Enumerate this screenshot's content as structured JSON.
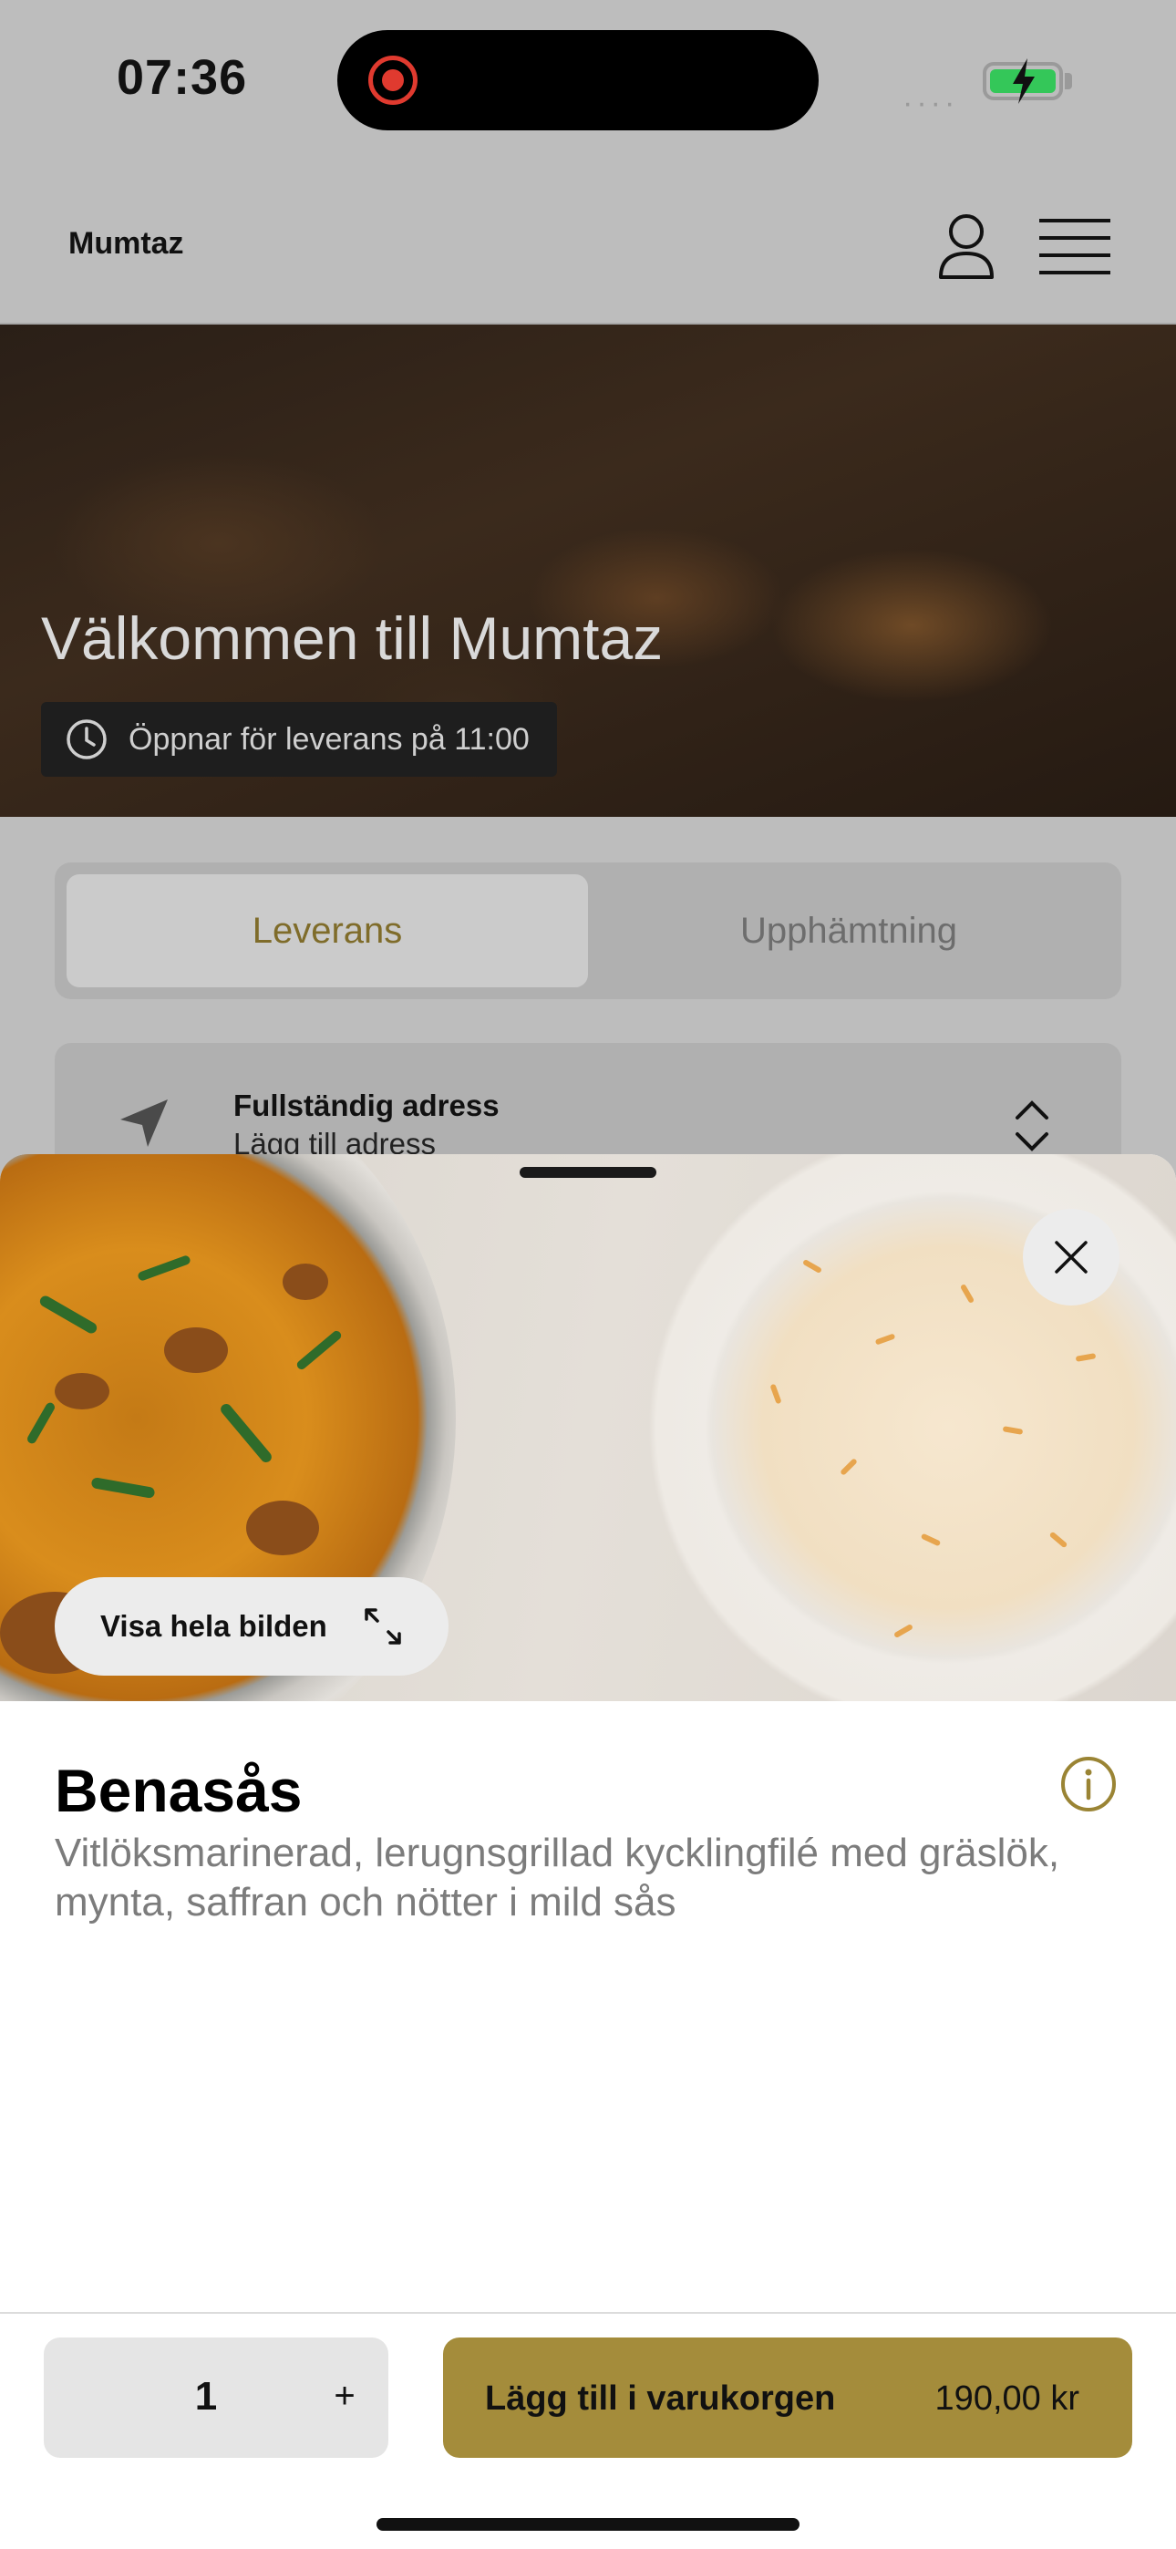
{
  "status_bar": {
    "time": "07:36",
    "signal": "····"
  },
  "header": {
    "brand": "Mumtaz"
  },
  "hero": {
    "title": "Välkommen till Mumtaz",
    "badge": "Öppnar för leverans på 11:00"
  },
  "tabs": {
    "delivery": "Leverans",
    "pickup": "Upphämtning",
    "active": "Leverans"
  },
  "address": {
    "title": "Fullständig adress",
    "subtitle": "Lägg till adress"
  },
  "product": {
    "view_full_image": "Visa hela bilden",
    "name": "Benasås",
    "description": "Vitlöksmarinerad, lerugnsgrillad kycklingfilé med gräslök, mynta, saffran och nötter i mild sås"
  },
  "footer": {
    "quantity": "1",
    "plus": "+",
    "add_to_cart": "Lägg till i varukorgen",
    "price": "190,00 kr"
  },
  "colors": {
    "accent": "#a48c3b",
    "accent_text": "#7f6c2a",
    "dim_background": "#bdbdbd"
  }
}
